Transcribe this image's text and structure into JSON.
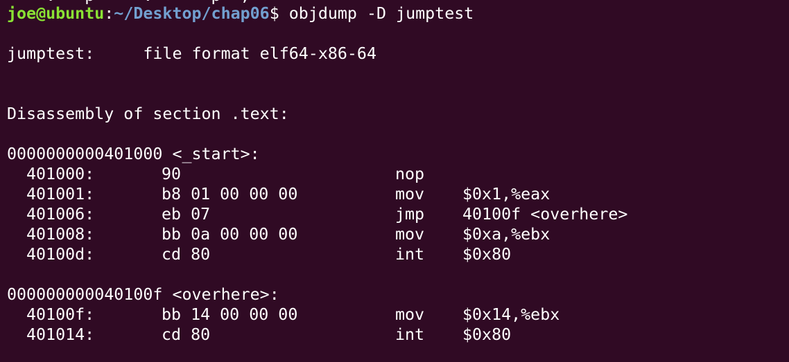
{
  "terminal": {
    "background": "#300a24",
    "foreground": "#ffffff",
    "user_color": "#8ae234",
    "path_color": "#729fcf",
    "cut_previous_line": "    .   p     .      p  ;",
    "prompt": {
      "user_host": "joe@ubuntu",
      "colon": ":",
      "path": "~/Desktop/chap06",
      "dollar": "$",
      "command": " objdump -D jumptest"
    },
    "file_format_line": "jumptest:     file format elf64-x86-64",
    "disassembly_header": "Disassembly of section .text:",
    "sections": [
      {
        "label": "0000000000401000 <_start>:",
        "instructions": [
          {
            "address": "401000:",
            "bytes": "90",
            "mnemonic": "nop",
            "operands": ""
          },
          {
            "address": "401001:",
            "bytes": "b8 01 00 00 00",
            "mnemonic": "mov",
            "operands": "$0x1,%eax"
          },
          {
            "address": "401006:",
            "bytes": "eb 07",
            "mnemonic": "jmp",
            "operands": "40100f <overhere>"
          },
          {
            "address": "401008:",
            "bytes": "bb 0a 00 00 00",
            "mnemonic": "mov",
            "operands": "$0xa,%ebx"
          },
          {
            "address": "40100d:",
            "bytes": "cd 80",
            "mnemonic": "int",
            "operands": "$0x80"
          }
        ]
      },
      {
        "label": "000000000040100f <overhere>:",
        "instructions": [
          {
            "address": "40100f:",
            "bytes": "bb 14 00 00 00",
            "mnemonic": "mov",
            "operands": "$0x14,%ebx"
          },
          {
            "address": "401014:",
            "bytes": "cd 80",
            "mnemonic": "int",
            "operands": "$0x80"
          }
        ]
      }
    ]
  }
}
